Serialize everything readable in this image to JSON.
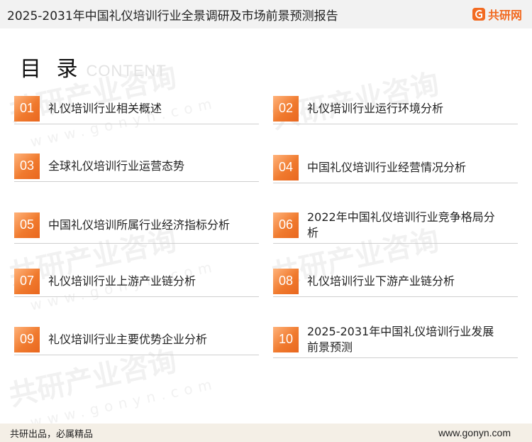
{
  "header": {
    "title": "2025-2031年中国礼仪培训行业全景调研及市场前景预测报告",
    "brand": "共研网",
    "brand_color": "#f26a21"
  },
  "toc": {
    "heading": "目 录",
    "heading_sub": "CONTENT",
    "items": [
      {
        "num": "01",
        "label": "礼仪培训行业相关概述"
      },
      {
        "num": "02",
        "label": "礼仪培训行业运行环境分析"
      },
      {
        "num": "03",
        "label": "全球礼仪培训行业运营态势"
      },
      {
        "num": "04",
        "label": "中国礼仪培训行业经营情况分析"
      },
      {
        "num": "05",
        "label": "中国礼仪培训所属行业经济指标分析"
      },
      {
        "num": "06",
        "label": "2022年中国礼仪培训行业竞争格局分析"
      },
      {
        "num": "07",
        "label": "礼仪培训行业上游产业链分析"
      },
      {
        "num": "08",
        "label": "礼仪培训行业下游产业链分析"
      },
      {
        "num": "09",
        "label": "礼仪培训行业主要优势企业分析"
      },
      {
        "num": "10",
        "label": "2025-2031年中国礼仪培训行业发展前景预测"
      }
    ]
  },
  "watermark": {
    "text": "共研产业咨询",
    "url": "www.gonyn.com"
  },
  "footer": {
    "left": "共研出品，必属精品",
    "right": "www.gonyn.com"
  },
  "colors": {
    "accent": "#f07a2e",
    "footer_bg": "#f4efe6"
  }
}
